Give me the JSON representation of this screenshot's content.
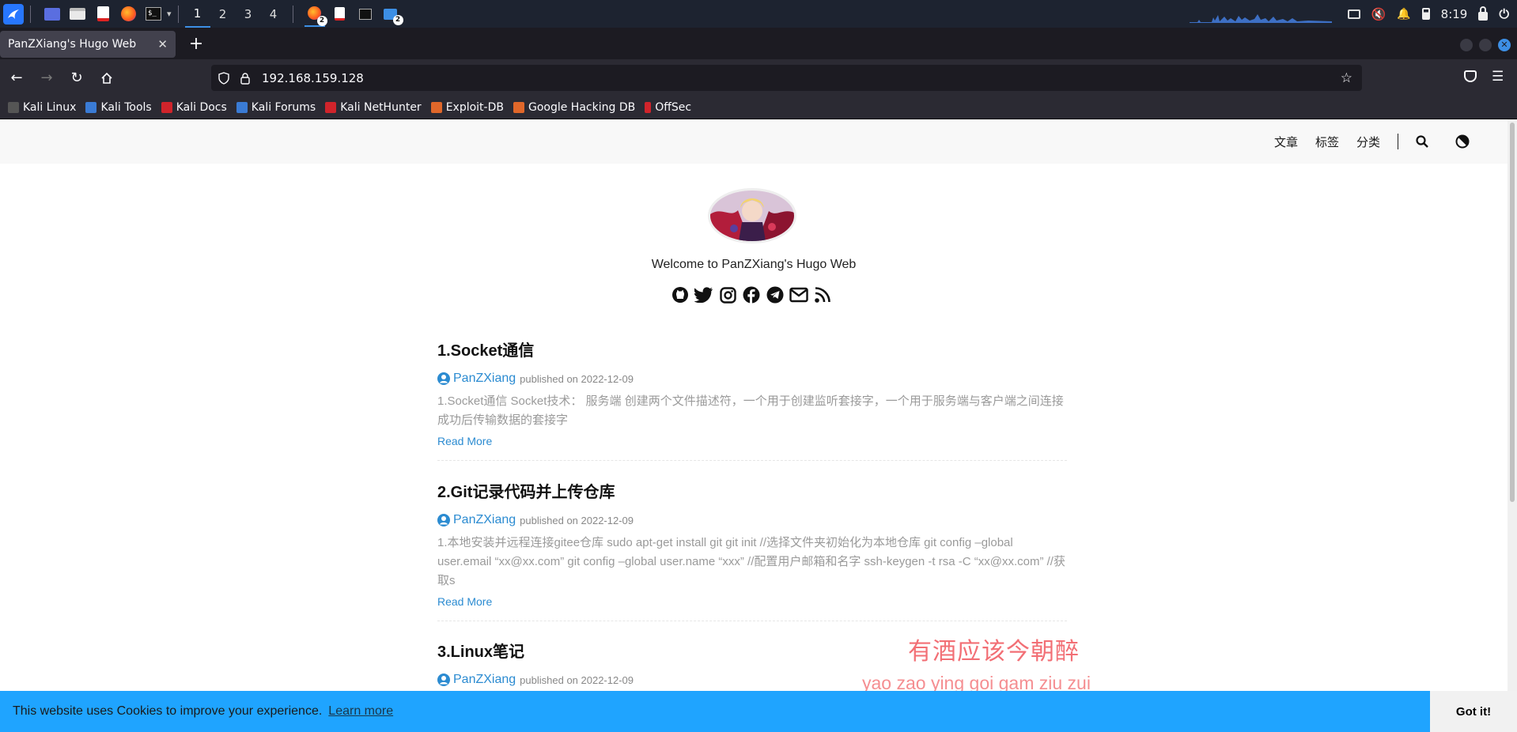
{
  "taskbar": {
    "workspaces": [
      "1",
      "2",
      "3",
      "4"
    ],
    "active_workspace": "1",
    "badge_count": "2",
    "clock": "8:19"
  },
  "browser": {
    "tab_title": "PanZXiang's Hugo Web",
    "url": "192.168.159.128",
    "bookmarks": [
      {
        "label": "Kali Linux",
        "color": "#555555"
      },
      {
        "label": "Kali Tools",
        "color": "#3a7bd5"
      },
      {
        "label": "Kali Docs",
        "color": "#d0242b"
      },
      {
        "label": "Kali Forums",
        "color": "#3a7bd5"
      },
      {
        "label": "Kali NetHunter",
        "color": "#d0242b"
      },
      {
        "label": "Exploit-DB",
        "color": "#e0672a"
      },
      {
        "label": "Google Hacking DB",
        "color": "#e0672a"
      },
      {
        "label": "OffSec",
        "color": "#d0242b"
      }
    ]
  },
  "site": {
    "menu": [
      "文章",
      "标签",
      "分类"
    ],
    "welcome": "Welcome to PanZXiang's Hugo Web",
    "socials": [
      "github-icon",
      "twitter-icon",
      "instagram-icon",
      "facebook-icon",
      "telegram-icon",
      "email-icon",
      "rss-icon"
    ],
    "posts": [
      {
        "title": "1.Socket通信",
        "author": "PanZXiang",
        "published": "published on 2022-12-09",
        "summary": "1.Socket通信 Socket技术： 服务端 创建两个文件描述符，一个用于创建监听套接字，一个用于服务端与客户端之间连接成功后传输数据的套接字",
        "read_more": "Read More"
      },
      {
        "title": "2.Git记录代码并上传仓库",
        "author": "PanZXiang",
        "published": "published on 2022-12-09",
        "summary": "1.本地安装并远程连接gitee仓库 sudo apt-get install git git init //选择文件夹初始化为本地仓库 git config –global user.email “xx@xx.com” git config –global user.name “xxx” //配置用户邮箱和名字 ssh-keygen -t rsa -C “xx@xx.com” //获取s",
        "read_more": "Read More"
      },
      {
        "title": "3.Linux笔记",
        "author": "PanZXiang",
        "published": "published on 2022-12-09"
      }
    ],
    "poem_line": "有酒应该今朝醉",
    "poem_romanization": "yao zao ying goi gam ziu zui"
  },
  "cookie": {
    "message": "This website uses Cookies to improve your experience.",
    "learn_more": "Learn more",
    "button": "Got it!"
  },
  "colors": {
    "accent": "#2b8bd1",
    "cookie_bar": "#1fa4ff",
    "poem": "#f26f75"
  }
}
